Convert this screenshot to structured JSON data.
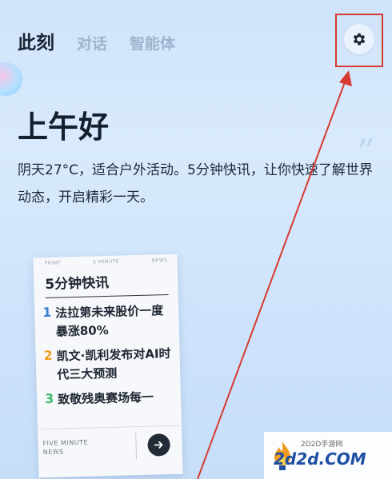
{
  "header": {
    "tabs": [
      {
        "label": "此刻",
        "active": true
      },
      {
        "label": "对话",
        "active": false
      },
      {
        "label": "智能体",
        "active": false
      }
    ],
    "settings_icon": "gear-icon"
  },
  "greeting": "上午好",
  "description": "阴天27°C，适合户外活动。5分钟快讯，让你快速了解世界动态，开启精彩一天。",
  "card": {
    "top_labels": [
      "PRINT",
      "5 MINUTE",
      "NEWS"
    ],
    "title": "5分钟快讯",
    "items": [
      {
        "num": "1",
        "text": "法拉第未来股价一度暴涨80%",
        "color": "#3a7fd8"
      },
      {
        "num": "2",
        "text": "凯文·凯利发布对AI时代三大预测",
        "color": "#f0a020"
      },
      {
        "num": "3",
        "text": "致敬残奥赛场每一",
        "color": "#3dbb6a"
      }
    ],
    "footer_line1": "FIVE MINUTE",
    "footer_line2": "NEWS",
    "next_icon": "arrow-right-icon"
  },
  "watermark": {
    "small": "2D2D手游网",
    "large": "2d2d.COM"
  },
  "colors": {
    "annotation_red": "#d63a30",
    "text_dark": "#1b2433",
    "tab_inactive": "#9fb3cc"
  }
}
